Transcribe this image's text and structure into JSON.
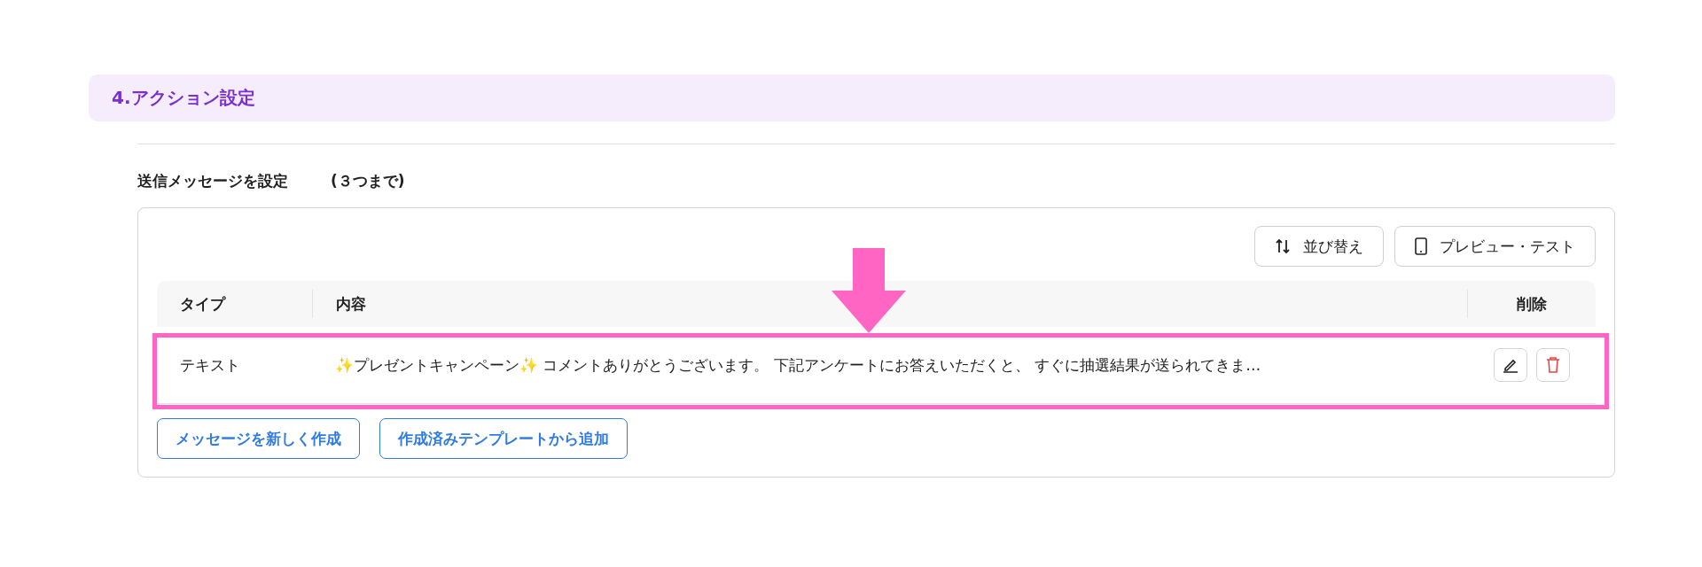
{
  "section": {
    "title": "4.アクション設定"
  },
  "messages": {
    "label": "送信メッセージを設定",
    "limit": "(３つまで)",
    "toolbar": [
      {
        "kind": "sort",
        "label": "並び替え"
      },
      {
        "kind": "preview",
        "label": "プレビュー・テスト"
      }
    ],
    "table": {
      "columns": [
        "タイプ",
        "内容",
        "削除"
      ],
      "rows": [
        {
          "type": "テキスト",
          "content": "✨プレゼントキャンペーン✨ コメントありがとうございます。 下記アンケートにお答えいただくと、 すぐに抽選結果が送られてきま…"
        }
      ]
    },
    "buttons": [
      "メッセージを新しく作成",
      "作成済みテンプレートから追加"
    ]
  }
}
